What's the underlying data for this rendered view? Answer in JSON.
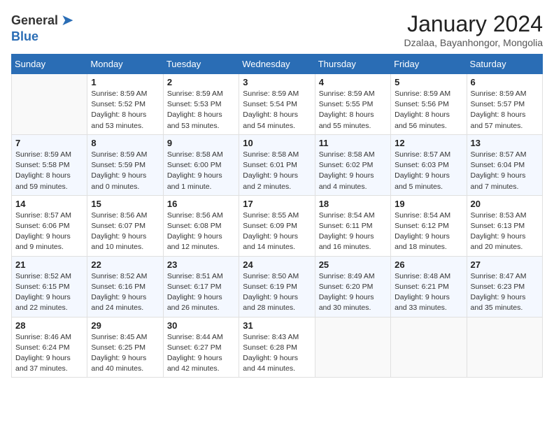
{
  "logo": {
    "general": "General",
    "blue": "Blue"
  },
  "title": {
    "month": "January 2024",
    "location": "Dzalaa, Bayanhongor, Mongolia"
  },
  "headers": [
    "Sunday",
    "Monday",
    "Tuesday",
    "Wednesday",
    "Thursday",
    "Friday",
    "Saturday"
  ],
  "weeks": [
    [
      {
        "day": "",
        "sunrise": "",
        "sunset": "",
        "daylight": ""
      },
      {
        "day": "1",
        "sunrise": "Sunrise: 8:59 AM",
        "sunset": "Sunset: 5:52 PM",
        "daylight": "Daylight: 8 hours and 53 minutes."
      },
      {
        "day": "2",
        "sunrise": "Sunrise: 8:59 AM",
        "sunset": "Sunset: 5:53 PM",
        "daylight": "Daylight: 8 hours and 53 minutes."
      },
      {
        "day": "3",
        "sunrise": "Sunrise: 8:59 AM",
        "sunset": "Sunset: 5:54 PM",
        "daylight": "Daylight: 8 hours and 54 minutes."
      },
      {
        "day": "4",
        "sunrise": "Sunrise: 8:59 AM",
        "sunset": "Sunset: 5:55 PM",
        "daylight": "Daylight: 8 hours and 55 minutes."
      },
      {
        "day": "5",
        "sunrise": "Sunrise: 8:59 AM",
        "sunset": "Sunset: 5:56 PM",
        "daylight": "Daylight: 8 hours and 56 minutes."
      },
      {
        "day": "6",
        "sunrise": "Sunrise: 8:59 AM",
        "sunset": "Sunset: 5:57 PM",
        "daylight": "Daylight: 8 hours and 57 minutes."
      }
    ],
    [
      {
        "day": "7",
        "sunrise": "Sunrise: 8:59 AM",
        "sunset": "Sunset: 5:58 PM",
        "daylight": "Daylight: 8 hours and 59 minutes."
      },
      {
        "day": "8",
        "sunrise": "Sunrise: 8:59 AM",
        "sunset": "Sunset: 5:59 PM",
        "daylight": "Daylight: 9 hours and 0 minutes."
      },
      {
        "day": "9",
        "sunrise": "Sunrise: 8:58 AM",
        "sunset": "Sunset: 6:00 PM",
        "daylight": "Daylight: 9 hours and 1 minute."
      },
      {
        "day": "10",
        "sunrise": "Sunrise: 8:58 AM",
        "sunset": "Sunset: 6:01 PM",
        "daylight": "Daylight: 9 hours and 2 minutes."
      },
      {
        "day": "11",
        "sunrise": "Sunrise: 8:58 AM",
        "sunset": "Sunset: 6:02 PM",
        "daylight": "Daylight: 9 hours and 4 minutes."
      },
      {
        "day": "12",
        "sunrise": "Sunrise: 8:57 AM",
        "sunset": "Sunset: 6:03 PM",
        "daylight": "Daylight: 9 hours and 5 minutes."
      },
      {
        "day": "13",
        "sunrise": "Sunrise: 8:57 AM",
        "sunset": "Sunset: 6:04 PM",
        "daylight": "Daylight: 9 hours and 7 minutes."
      }
    ],
    [
      {
        "day": "14",
        "sunrise": "Sunrise: 8:57 AM",
        "sunset": "Sunset: 6:06 PM",
        "daylight": "Daylight: 9 hours and 9 minutes."
      },
      {
        "day": "15",
        "sunrise": "Sunrise: 8:56 AM",
        "sunset": "Sunset: 6:07 PM",
        "daylight": "Daylight: 9 hours and 10 minutes."
      },
      {
        "day": "16",
        "sunrise": "Sunrise: 8:56 AM",
        "sunset": "Sunset: 6:08 PM",
        "daylight": "Daylight: 9 hours and 12 minutes."
      },
      {
        "day": "17",
        "sunrise": "Sunrise: 8:55 AM",
        "sunset": "Sunset: 6:09 PM",
        "daylight": "Daylight: 9 hours and 14 minutes."
      },
      {
        "day": "18",
        "sunrise": "Sunrise: 8:54 AM",
        "sunset": "Sunset: 6:11 PM",
        "daylight": "Daylight: 9 hours and 16 minutes."
      },
      {
        "day": "19",
        "sunrise": "Sunrise: 8:54 AM",
        "sunset": "Sunset: 6:12 PM",
        "daylight": "Daylight: 9 hours and 18 minutes."
      },
      {
        "day": "20",
        "sunrise": "Sunrise: 8:53 AM",
        "sunset": "Sunset: 6:13 PM",
        "daylight": "Daylight: 9 hours and 20 minutes."
      }
    ],
    [
      {
        "day": "21",
        "sunrise": "Sunrise: 8:52 AM",
        "sunset": "Sunset: 6:15 PM",
        "daylight": "Daylight: 9 hours and 22 minutes."
      },
      {
        "day": "22",
        "sunrise": "Sunrise: 8:52 AM",
        "sunset": "Sunset: 6:16 PM",
        "daylight": "Daylight: 9 hours and 24 minutes."
      },
      {
        "day": "23",
        "sunrise": "Sunrise: 8:51 AM",
        "sunset": "Sunset: 6:17 PM",
        "daylight": "Daylight: 9 hours and 26 minutes."
      },
      {
        "day": "24",
        "sunrise": "Sunrise: 8:50 AM",
        "sunset": "Sunset: 6:19 PM",
        "daylight": "Daylight: 9 hours and 28 minutes."
      },
      {
        "day": "25",
        "sunrise": "Sunrise: 8:49 AM",
        "sunset": "Sunset: 6:20 PM",
        "daylight": "Daylight: 9 hours and 30 minutes."
      },
      {
        "day": "26",
        "sunrise": "Sunrise: 8:48 AM",
        "sunset": "Sunset: 6:21 PM",
        "daylight": "Daylight: 9 hours and 33 minutes."
      },
      {
        "day": "27",
        "sunrise": "Sunrise: 8:47 AM",
        "sunset": "Sunset: 6:23 PM",
        "daylight": "Daylight: 9 hours and 35 minutes."
      }
    ],
    [
      {
        "day": "28",
        "sunrise": "Sunrise: 8:46 AM",
        "sunset": "Sunset: 6:24 PM",
        "daylight": "Daylight: 9 hours and 37 minutes."
      },
      {
        "day": "29",
        "sunrise": "Sunrise: 8:45 AM",
        "sunset": "Sunset: 6:25 PM",
        "daylight": "Daylight: 9 hours and 40 minutes."
      },
      {
        "day": "30",
        "sunrise": "Sunrise: 8:44 AM",
        "sunset": "Sunset: 6:27 PM",
        "daylight": "Daylight: 9 hours and 42 minutes."
      },
      {
        "day": "31",
        "sunrise": "Sunrise: 8:43 AM",
        "sunset": "Sunset: 6:28 PM",
        "daylight": "Daylight: 9 hours and 44 minutes."
      },
      {
        "day": "",
        "sunrise": "",
        "sunset": "",
        "daylight": ""
      },
      {
        "day": "",
        "sunrise": "",
        "sunset": "",
        "daylight": ""
      },
      {
        "day": "",
        "sunrise": "",
        "sunset": "",
        "daylight": ""
      }
    ]
  ]
}
